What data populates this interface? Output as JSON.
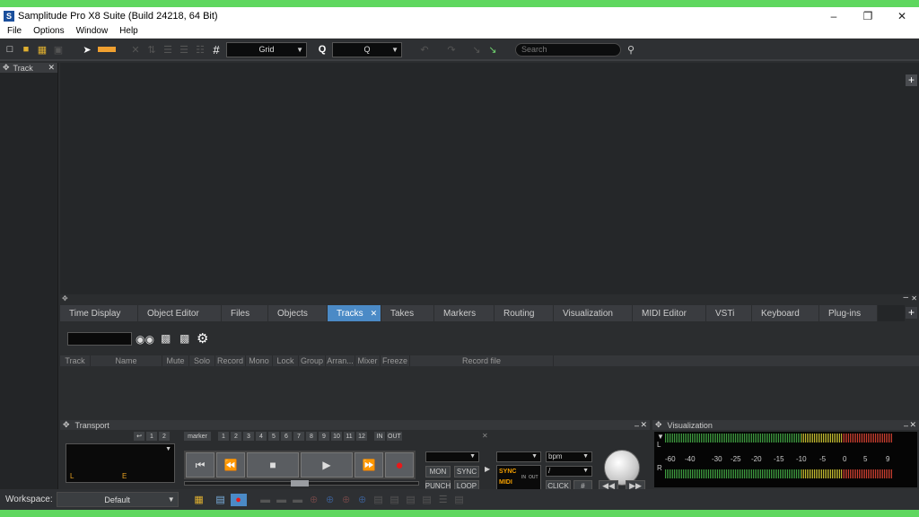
{
  "window": {
    "title": "Samplitude Pro X8 Suite (Build 24218, 64 Bit)",
    "minimize": "–",
    "restore": "❐",
    "close": "✕"
  },
  "menu": [
    "File",
    "Options",
    "Window",
    "Help"
  ],
  "toolbar": {
    "grid_label": "Grid",
    "quantize_label": "Q",
    "search_placeholder": "Search"
  },
  "left_panel": {
    "title": "Track"
  },
  "manager": {
    "tabs": [
      "Time Display",
      "Object Editor",
      "Files",
      "Objects",
      "Tracks",
      "Takes",
      "Markers",
      "Routing",
      "Visualization",
      "MIDI Editor",
      "VSTi",
      "Keyboard",
      "Plug-ins"
    ],
    "active_tab": "Tracks",
    "columns": [
      "Track",
      "Name",
      "Mute",
      "Solo",
      "Record",
      "Mono",
      "Lock",
      "Group",
      "Arran...",
      "Mixer",
      "Freeze",
      "Record file"
    ]
  },
  "transport": {
    "title": "Transport",
    "marker_label": "marker",
    "marker_numbers": [
      "1",
      "2",
      "3",
      "4",
      "5",
      "6",
      "7",
      "8",
      "9",
      "10",
      "11",
      "12"
    ],
    "group_numbers": [
      "1",
      "2"
    ],
    "in_label": "IN",
    "out_label": "OUT",
    "lcd_left": "L",
    "lcd_right": "E",
    "mon_label": "MON",
    "sync_label": "SYNC",
    "punch_label": "PUNCH",
    "loop_label": "LOOP",
    "sync_led": "SYNC",
    "midi_led": "MIDI",
    "in_led": "IN",
    "out_led": "OUT",
    "bpm_label": "bpm",
    "sig_label": "/",
    "click_label": "CLICK"
  },
  "visualization": {
    "title": "Visualization",
    "channel_l": "L",
    "channel_r": "R",
    "scale": [
      "-60",
      "-40",
      "-30",
      "-25",
      "-20",
      "-15",
      "-10",
      "-5",
      "0",
      "5",
      "9"
    ]
  },
  "workspace": {
    "label": "Workspace:",
    "value": "Default"
  },
  "colors": {
    "accent_tab": "#4b8ac6",
    "record": "#e8191a",
    "led_orange": "#f5a000",
    "frame_green": "#5fd75f"
  }
}
